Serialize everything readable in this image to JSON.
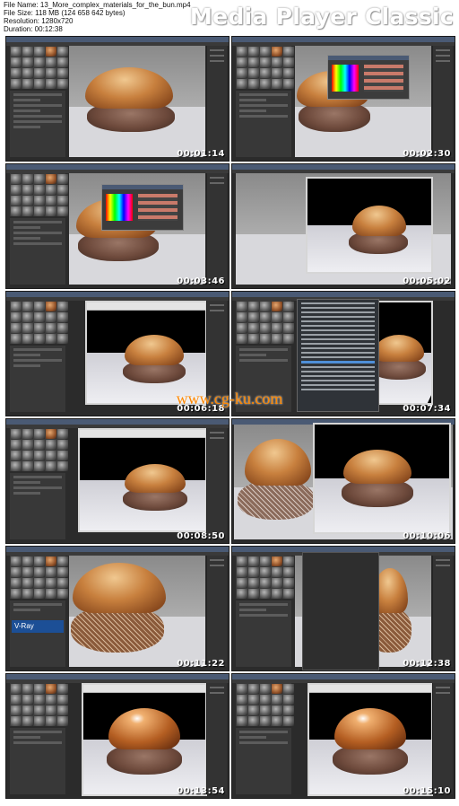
{
  "header": {
    "file_name": "File Name: 13_More_complex_materials_for_the_bun.mp4",
    "file_size": "File Size: 118 MB (124 658 642 bytes)",
    "resolution": "Resolution: 1280x720",
    "duration": "Duration: 00:12:38",
    "brand": "Media Player Classic"
  },
  "thumbnails": [
    {
      "timestamp": "00:01:14",
      "scene": "viewport"
    },
    {
      "timestamp": "00:02:30",
      "scene": "viewport-color-dialog"
    },
    {
      "timestamp": "00:03:46",
      "scene": "viewport-color-dialog"
    },
    {
      "timestamp": "00:05:02",
      "scene": "render"
    },
    {
      "timestamp": "00:06:18",
      "scene": "render"
    },
    {
      "timestamp": "00:07:34",
      "scene": "render-menu"
    },
    {
      "timestamp": "00:08:50",
      "scene": "render"
    },
    {
      "timestamp": "00:10:06",
      "scene": "render-wire"
    },
    {
      "timestamp": "00:11:22",
      "scene": "closeup-vray"
    },
    {
      "timestamp": "00:12:38",
      "scene": "closeup-panel"
    },
    {
      "timestamp": "00:13:54",
      "scene": "render-glossy"
    },
    {
      "timestamp": "00:15:10",
      "scene": "render-glossy"
    }
  ],
  "vray_label": "V-Ray",
  "watermark": "www.cg-ku.com"
}
